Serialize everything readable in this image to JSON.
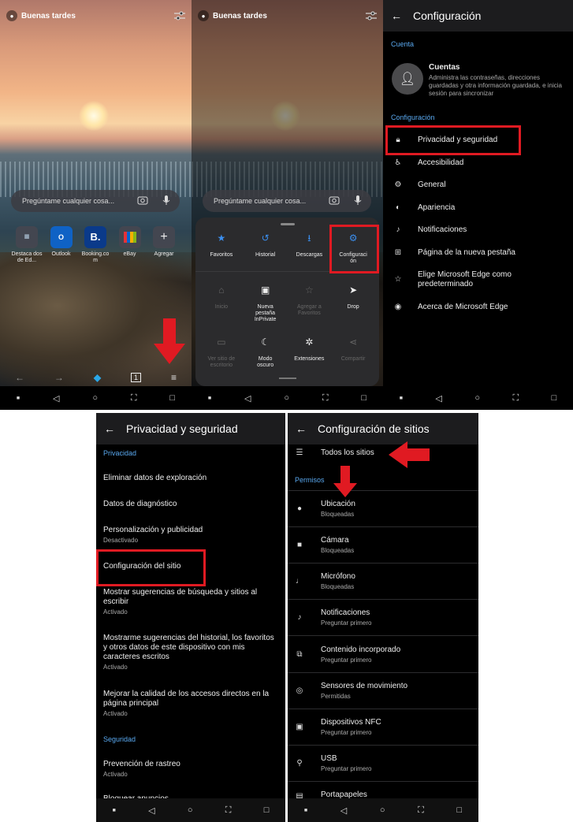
{
  "home": {
    "greeting": "Buenas tardes",
    "search_placeholder": "Pregúntame cualquier cosa...",
    "tiles": [
      {
        "label": "Destaca dos de Ed...",
        "icon": "grid-icon"
      },
      {
        "label": "Outlook",
        "icon": "outlook-icon"
      },
      {
        "label": "Booking.co m",
        "icon": "booking-icon",
        "glyph": "B."
      },
      {
        "label": "eBay",
        "icon": "ebay-icon"
      },
      {
        "label": "Agregar",
        "icon": "plus-icon",
        "glyph": "+"
      }
    ]
  },
  "menu": {
    "row1": [
      {
        "label": "Favoritos",
        "icon": "star-icon",
        "glyph": "★"
      },
      {
        "label": "Historial",
        "icon": "history-icon",
        "glyph": "↺"
      },
      {
        "label": "Descargas",
        "icon": "download-icon",
        "glyph": "⭳"
      },
      {
        "label": "Configuraci ón",
        "icon": "gear-icon",
        "glyph": "⚙"
      }
    ],
    "row2": [
      {
        "label": "Inicio",
        "icon": "home-icon",
        "glyph": "⌂",
        "disabled": true
      },
      {
        "label": "Nueva pestaña InPrivate",
        "icon": "inprivate-icon",
        "glyph": "▣",
        "disabled": false
      },
      {
        "label": "Agregar a Favoritos",
        "icon": "add-favorite-icon",
        "glyph": "☆",
        "disabled": true
      },
      {
        "label": "Drop",
        "icon": "send-icon",
        "glyph": "➤",
        "disabled": false
      }
    ],
    "row3": [
      {
        "label": "Ver sitio de escritorio",
        "icon": "desktop-icon",
        "glyph": "▭",
        "disabled": true
      },
      {
        "label": "Modo oscuro",
        "icon": "moon-icon",
        "glyph": "☾",
        "disabled": false
      },
      {
        "label": "Extensiones",
        "icon": "puzzle-icon",
        "glyph": "✲",
        "disabled": false
      },
      {
        "label": "Compartir",
        "icon": "share-icon",
        "glyph": "⋖",
        "disabled": true
      }
    ]
  },
  "settings": {
    "title": "Configuración",
    "section_account": "Cuenta",
    "account_title": "Cuentas",
    "account_desc": "Administra las contraseñas, direcciones guardadas y otra información guardada, e inicia sesión para sincronizar",
    "section_config": "Configuración",
    "items": [
      {
        "label": "Privacidad y seguridad",
        "icon": "lock-icon",
        "glyph": "🔒︎"
      },
      {
        "label": "Accesibilidad",
        "icon": "accessibility-icon",
        "glyph": "♿︎"
      },
      {
        "label": "General",
        "icon": "gear-icon",
        "glyph": "⚙"
      },
      {
        "label": "Apariencia",
        "icon": "palette-icon",
        "glyph": "◐"
      },
      {
        "label": "Notificaciones",
        "icon": "bell-icon",
        "glyph": "♪"
      },
      {
        "label": "Página de la nueva pestaña",
        "icon": "new-tab-icon",
        "glyph": "⊞"
      },
      {
        "label": "Elige Microsoft Edge como predeterminado",
        "icon": "star-check-icon",
        "glyph": "☆"
      },
      {
        "label": "Acerca de Microsoft Edge",
        "icon": "edge-icon",
        "glyph": "◉"
      }
    ]
  },
  "privacy": {
    "title": "Privacidad y seguridad",
    "section_privacy": "Privacidad",
    "items": [
      {
        "label": "Eliminar datos de exploración",
        "sub": ""
      },
      {
        "label": "Datos de diagnóstico",
        "sub": ""
      },
      {
        "label": "Personalización y publicidad",
        "sub": "Desactivado"
      },
      {
        "label": "Configuración del sitio",
        "sub": ""
      },
      {
        "label": "Mostrar sugerencias de búsqueda y sitios al escribir",
        "sub": "Activado"
      },
      {
        "label": "Mostrarme sugerencias del historial, los favoritos y otros datos de este dispositivo con mis caracteres escritos",
        "sub": "Activado"
      },
      {
        "label": "Mejorar la calidad de los accesos directos en la página principal",
        "sub": "Activado"
      }
    ],
    "section_security": "Seguridad",
    "security_items": [
      {
        "label": "Prevención de rastreo",
        "sub": "Activado"
      },
      {
        "label": "Bloquear anuncios",
        "sub": ""
      }
    ]
  },
  "site_settings": {
    "title": "Configuración de sitios",
    "all_sites": "Todos los sitios",
    "section_permissions": "Permisos",
    "items": [
      {
        "label": "Ubicación",
        "sub": "Bloqueadas",
        "icon": "location-icon",
        "glyph": "●"
      },
      {
        "label": "Cámara",
        "sub": "Bloqueadas",
        "icon": "camera-icon",
        "glyph": "■"
      },
      {
        "label": "Micrófono",
        "sub": "Bloqueadas",
        "icon": "microphone-icon",
        "glyph": "♩"
      },
      {
        "label": "Notificaciones",
        "sub": "Preguntar primero",
        "icon": "bell-icon",
        "glyph": "♪"
      },
      {
        "label": "Contenido incorporado",
        "sub": "Preguntar primero",
        "icon": "embedded-icon",
        "glyph": "⧉"
      },
      {
        "label": "Sensores de movimiento",
        "sub": "Permitidas",
        "icon": "sensor-icon",
        "glyph": "◎"
      },
      {
        "label": "Dispositivos NFC",
        "sub": "Preguntar primero",
        "icon": "nfc-icon",
        "glyph": "▣"
      },
      {
        "label": "USB",
        "sub": "Preguntar primero",
        "icon": "usb-icon",
        "glyph": "⚲"
      },
      {
        "label": "Portapapeles",
        "sub": "",
        "icon": "clipboard-icon",
        "glyph": "▤"
      }
    ]
  },
  "colors": {
    "accent": "#3b8ff0",
    "highlight": "#e01a22",
    "section": "#5aa9f0"
  }
}
